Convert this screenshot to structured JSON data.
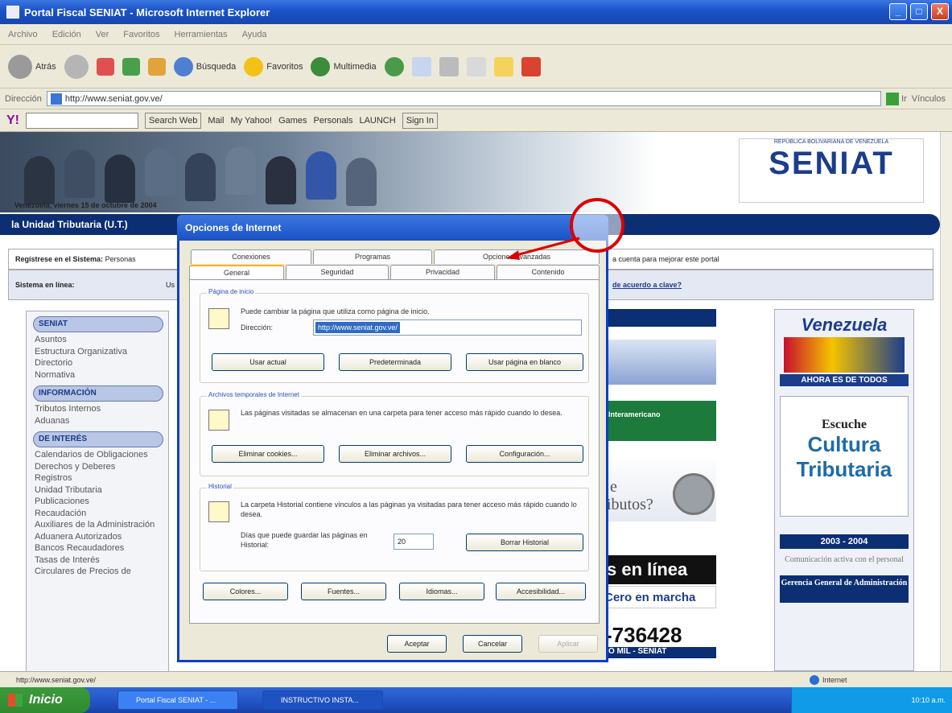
{
  "window": {
    "title": "Portal Fiscal SENIAT - Microsoft Internet Explorer",
    "min": "_",
    "max": "□",
    "close": "X"
  },
  "menu": [
    "Archivo",
    "Edición",
    "Ver",
    "Favoritos",
    "Herramientas",
    "Ayuda"
  ],
  "toolbar": {
    "back": "Atrás",
    "search": "Búsqueda",
    "favorites": "Favoritos",
    "multimedia": "Multimedia"
  },
  "address": {
    "label": "Dirección",
    "url": "http://www.seniat.gov.ve/",
    "go": "Ir",
    "links": "Vínculos"
  },
  "yahoo": {
    "logo": "Y!",
    "search_btn": "Search Web",
    "mail": "Mail",
    "myyahoo": "My Yahoo!",
    "games": "Games",
    "personals": "Personals",
    "launch": "LAUNCH",
    "signin": "Sign In"
  },
  "page": {
    "date": "Venezuela, viernes 15 de octubre de 2004",
    "ut": "la Unidad Tributaria (U.T.)",
    "reg_label": "Regístrese en el Sistema:",
    "reg_text": "Personas",
    "reg_right": "a cuenta para mejorar este portal",
    "sis_label": "Sistema en línea:",
    "sis_mid": "Us",
    "sis_right": "de acuerdo a clave?",
    "logo": "SENIAT",
    "logo_sub": "REPÚBLICA BOLIVARIANA DE VENEZUELA",
    "nav": [
      {
        "head": "SENIAT",
        "items": [
          "Asuntos",
          "Estructura Organizativa",
          "Directorio",
          "Normativa"
        ]
      },
      {
        "head": "INFORMACIÓN",
        "items": [
          "Tributos Internos",
          "Aduanas"
        ]
      },
      {
        "head": "DE INTERÉS",
        "items": [
          "Calendarios de Obligaciones",
          "Derechos y Deberes",
          "Registros",
          "Unidad Tributaria",
          "Publicaciones",
          "Recaudación",
          "Auxiliares de la Administración Aduanera Autorizados",
          "Bancos Recaudadores",
          "Tasas de Interés",
          "Circulares de Precios de"
        ]
      }
    ],
    "center": {
      "enlinea": "s en línea",
      "cero": "Cero en marcha",
      "phone": "-736428",
      "phone_sub": "O MIL - SENIAT",
      "butos": "ibutos?",
      "e": "e",
      "interamericano": "Interamericano"
    },
    "right": {
      "venezuela": "Venezuela",
      "ahora": "AHORA ES DE TODOS",
      "escuche": "Escuche",
      "cultura": "Cultura",
      "tributaria": "Tributaria",
      "years": "2003 - 2004",
      "comm": "Comunicación activa con el personal",
      "gerencia": "Gerencia General de Administración"
    }
  },
  "dialog": {
    "title": "Opciones de Internet",
    "tabs_back": [
      "Conexiones",
      "Programas",
      "Opciones avanzadas"
    ],
    "tabs_front": [
      "General",
      "Seguridad",
      "Privacidad",
      "Contenido"
    ],
    "home": {
      "title": "Página de inicio",
      "text": "Puede cambiar la página que utiliza como página de inicio.",
      "dir_label": "Dirección:",
      "url": "http://www.seniat.gov.ve/",
      "b1": "Usar actual",
      "b2": "Predeterminada",
      "b3": "Usar página en blanco"
    },
    "temp": {
      "title": "Archivos temporales de Internet",
      "text": "Las páginas visitadas se almacenan en una carpeta para tener acceso más rápido cuando lo desea.",
      "b1": "Eliminar cookies...",
      "b2": "Eliminar archivos...",
      "b3": "Configuración..."
    },
    "hist": {
      "title": "Historial",
      "text": "La carpeta Historial contiene vínculos a las páginas ya visitadas para tener acceso más rápido cuando lo desea.",
      "days_label": "Días que puede guardar las páginas en Historial:",
      "days": "20",
      "b1": "Borrar Historial"
    },
    "bottom": {
      "b1": "Colores...",
      "b2": "Fuentes...",
      "b3": "Idiomas...",
      "b4": "Accesibilidad..."
    },
    "ok": "Aceptar",
    "cancel": "Cancelar",
    "apply": "Aplicar"
  },
  "status": {
    "url": "http://www.seniat.gov.ve/",
    "zone": "Internet"
  },
  "taskbar": {
    "start": "Inicio",
    "t1": "Portal Fiscal SENIAT - ...",
    "t2": "INSTRUCTIVO INSTA...",
    "clock": "10:10 a.m."
  }
}
